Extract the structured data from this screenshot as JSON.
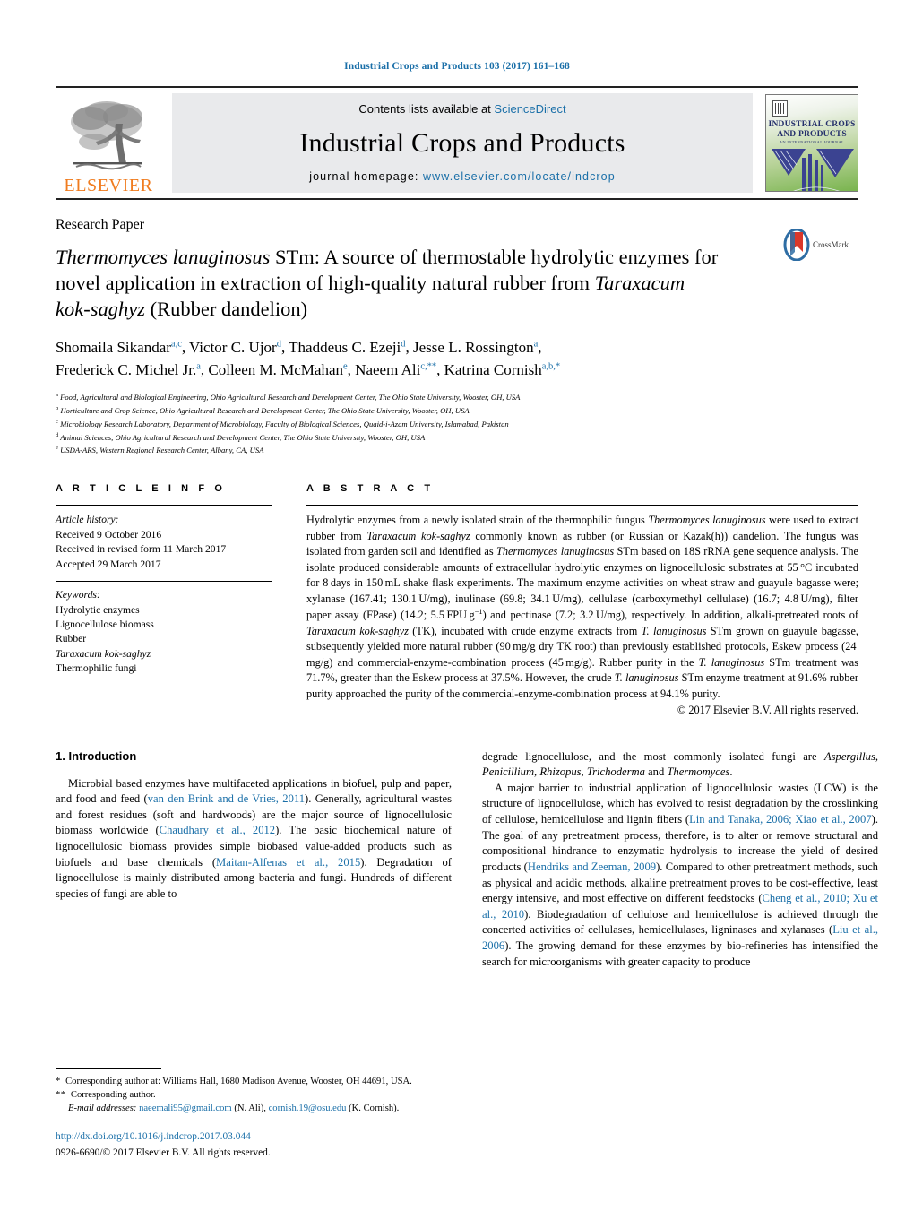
{
  "running_head": "Industrial Crops and Products 103 (2017) 161–168",
  "masthead": {
    "contents_prefix": "Contents lists available at ",
    "sciencedirect": "ScienceDirect",
    "journal_title": "Industrial Crops and Products",
    "homepage_prefix": "journal homepage: ",
    "homepage_url": "www.elsevier.com/locate/indcrop",
    "publisher": "ELSEVIER",
    "cover_line1": "INDUSTRIAL CROPS",
    "cover_line2": "AND PRODUCTS",
    "cover_line3": "AN INTERNATIONAL JOURNAL",
    "link_color": "#1a6fa8",
    "publisher_color": "#f07c1f"
  },
  "article": {
    "type": "Research Paper",
    "title_part1": "Thermomyces lanuginosus",
    "title_part2": " STm: A source of thermostable hydrolytic enzymes for novel application in extraction of high-quality natural rubber from ",
    "title_part3": "Taraxacum kok-saghyz",
    "title_part4": " (Rubber dandelion)",
    "crossmark_label": "CrossMark",
    "authors_line1": "Shomaila Sikandar",
    "authors_line1_sup1": "a,c",
    "authors_a2": ", Victor C. Ujor",
    "authors_a2_sup": "d",
    "authors_a3": ", Thaddeus C. Ezeji",
    "authors_a3_sup": "d",
    "authors_a4": ", Jesse L. Rossington",
    "authors_a4_sup": "a",
    "authors_a5": "Frederick C. Michel Jr.",
    "authors_a5_sup": "a",
    "authors_a6": ", Colleen M. McMahan",
    "authors_a6_sup": "e",
    "authors_a7": ", Naeem Ali",
    "authors_a7_sup": "c,**",
    "authors_a8": ", Katrina Cornish",
    "authors_a8_sup": "a,b,*"
  },
  "affiliations": [
    {
      "sup": "a",
      "text": "Food, Agricultural and Biological Engineering, Ohio Agricultural Research and Development Center, The Ohio State University, Wooster, OH, USA"
    },
    {
      "sup": "b",
      "text": "Horticulture and Crop Science, Ohio Agricultural Research and Development Center, The Ohio State University, Wooster, OH, USA"
    },
    {
      "sup": "c",
      "text": "Microbiology Research Laboratory, Department of Microbiology, Faculty of Biological Sciences, Quaid-i-Azam University, Islamabad, Pakistan"
    },
    {
      "sup": "d",
      "text": "Animal Sciences, Ohio Agricultural Research and Development Center, The Ohio State University, Wooster, OH, USA"
    },
    {
      "sup": "e",
      "text": "USDA-ARS, Western Regional Research Center, Albany, CA, USA"
    }
  ],
  "article_info": {
    "heading": "A R T I C L E  I N F O",
    "history_label": "Article history:",
    "history": [
      "Received 9 October 2016",
      "Received in revised form 11 March 2017",
      "Accepted 29 March 2017"
    ],
    "keywords_label": "Keywords:",
    "keywords": [
      "Hydrolytic enzymes",
      "Lignocellulose biomass",
      "Rubber",
      "Taraxacum kok-saghyz",
      "Thermophilic fungi"
    ],
    "keyword_italic_index": 3
  },
  "abstract": {
    "heading": "A B S T R A C T",
    "copyright": "© 2017 Elsevier B.V. All rights reserved."
  },
  "introduction": {
    "heading": "1.  Introduction"
  },
  "footnotes": {
    "corr1": "Corresponding author at: Williams Hall, 1680 Madison Avenue, Wooster, OH 44691, USA.",
    "corr2": "Corresponding author.",
    "email_label": "E-mail addresses:",
    "email1": "naeemali95@gmail.com",
    "email1_who": "(N. Ali),",
    "email2": "cornish.19@osu.edu",
    "email2_who": "(K. Cornish).",
    "doi": "http://dx.doi.org/10.1016/j.indcrop.2017.03.044",
    "issn": "0926-6690/© 2017 Elsevier B.V. All rights reserved."
  }
}
